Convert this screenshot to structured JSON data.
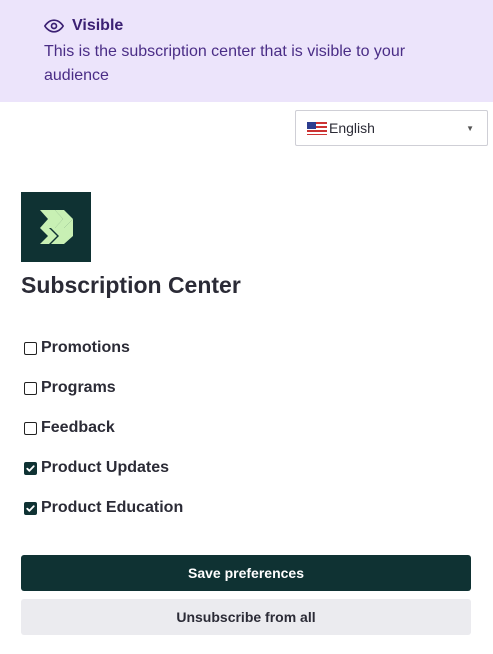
{
  "banner": {
    "title": "Visible",
    "text": "This is the subscription center that is visible to your audience",
    "icon": "eye-icon",
    "bg_color": "#ece4fb"
  },
  "language": {
    "selected": "English",
    "flag": "us-flag-icon"
  },
  "page": {
    "title": "Subscription Center",
    "brand_color": "#0f3233"
  },
  "options": [
    {
      "label": "Promotions",
      "checked": false
    },
    {
      "label": "Programs",
      "checked": false
    },
    {
      "label": "Feedback",
      "checked": false
    },
    {
      "label": "Product Updates",
      "checked": true
    },
    {
      "label": "Product Education",
      "checked": true
    }
  ],
  "buttons": {
    "save": "Save preferences",
    "unsubscribe": "Unsubscribe from all"
  }
}
